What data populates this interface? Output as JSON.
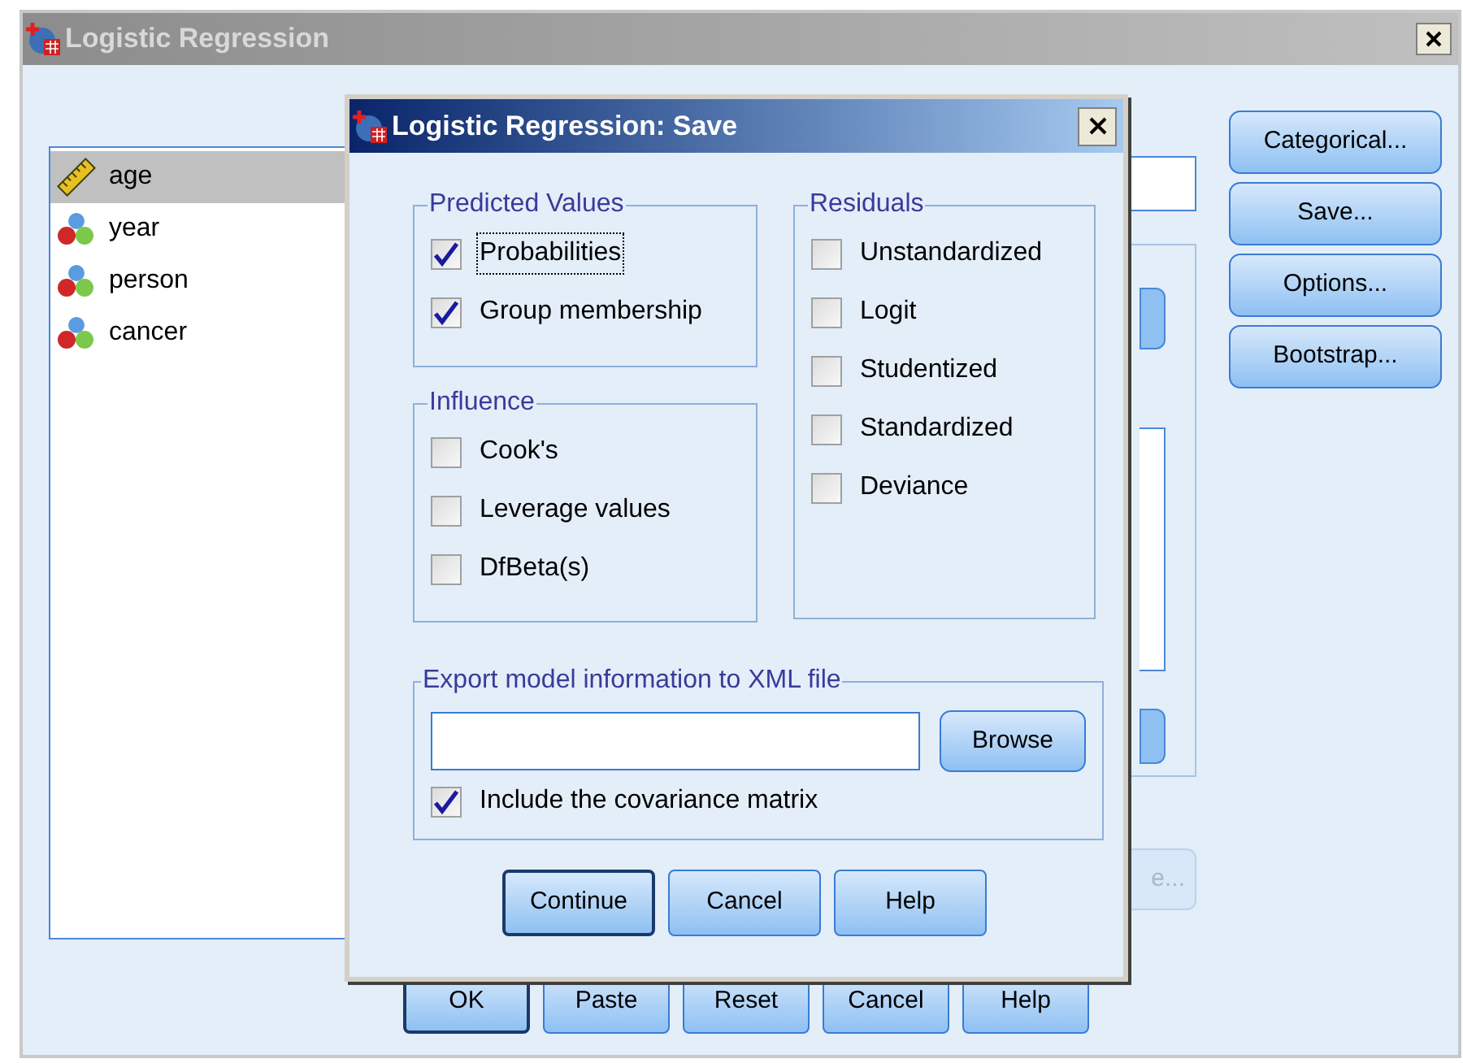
{
  "window": {
    "title": "Logistic Regression",
    "active": false
  },
  "variables": [
    {
      "name": "age",
      "kind": "scale",
      "selected": true
    },
    {
      "name": "year",
      "kind": "nominal",
      "selected": false
    },
    {
      "name": "person",
      "kind": "nominal",
      "selected": false
    },
    {
      "name": "cancer",
      "kind": "nominal",
      "selected": false
    }
  ],
  "side_buttons": [
    "Categorical...",
    "Save...",
    "Options...",
    "Bootstrap..."
  ],
  "hidden_button_fragment": {
    "label": "e...",
    "disabled": true
  },
  "bottom_buttons": [
    {
      "label": "OK",
      "default": true
    },
    {
      "label": "Paste",
      "default": false
    },
    {
      "label": "Reset",
      "default": false
    },
    {
      "label": "Cancel",
      "default": false
    },
    {
      "label": "Help",
      "default": false
    }
  ],
  "dialog": {
    "title": "Logistic Regression: Save",
    "active": true,
    "predicted_values": {
      "title": "Predicted Values",
      "items": [
        {
          "label": "Probabilities",
          "checked": true,
          "focused": true
        },
        {
          "label": "Group membership",
          "checked": true,
          "focused": false
        }
      ]
    },
    "influence": {
      "title": "Influence",
      "items": [
        {
          "label": "Cook's",
          "checked": false,
          "focused": false
        },
        {
          "label": "Leverage values",
          "checked": false,
          "focused": false
        },
        {
          "label": "DfBeta(s)",
          "checked": false,
          "focused": false
        }
      ]
    },
    "residuals": {
      "title": "Residuals",
      "items": [
        {
          "label": "Unstandardized",
          "checked": false,
          "focused": false
        },
        {
          "label": "Logit",
          "checked": false,
          "focused": false
        },
        {
          "label": "Studentized",
          "checked": false,
          "focused": false
        },
        {
          "label": "Standardized",
          "checked": false,
          "focused": false
        },
        {
          "label": "Deviance",
          "checked": false,
          "focused": false
        }
      ]
    },
    "export": {
      "title": "Export model information to XML file",
      "browse": "Browse",
      "include": {
        "label": "Include the covariance matrix",
        "checked": true,
        "focused": false
      }
    },
    "buttons": [
      {
        "label": "Continue",
        "default": true
      },
      {
        "label": "Cancel",
        "default": false
      },
      {
        "label": "Help",
        "default": false
      }
    ]
  }
}
